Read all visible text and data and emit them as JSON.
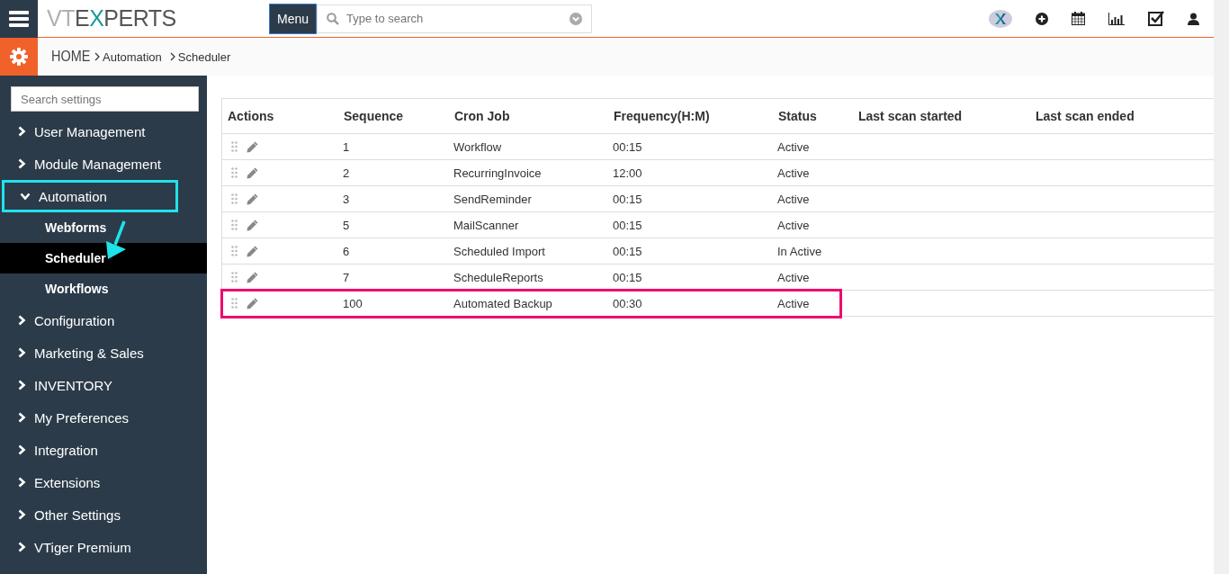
{
  "logo": [
    {
      "text": "VT",
      "color": "#b0b0b0"
    },
    {
      "text": "E",
      "color": "#555555"
    },
    {
      "text": "X",
      "color": "#1a9a9a"
    },
    {
      "text": "PERTS",
      "color": "#555555"
    }
  ],
  "menu_button": "Menu",
  "search": {
    "placeholder": "Type to search"
  },
  "breadcrumb": {
    "home": "HOME",
    "items": [
      "Automation",
      "Scheduler"
    ]
  },
  "sidebar": {
    "search_placeholder": "Search settings",
    "items": [
      {
        "label": "User Management",
        "expanded": false,
        "highlighted": false
      },
      {
        "label": "Module Management",
        "expanded": false,
        "highlighted": false
      },
      {
        "label": "Automation",
        "expanded": true,
        "highlighted": true,
        "children": [
          {
            "label": "Webforms",
            "selected": false
          },
          {
            "label": "Scheduler",
            "selected": true
          },
          {
            "label": "Workflows",
            "selected": false
          }
        ]
      },
      {
        "label": "Configuration",
        "expanded": false,
        "highlighted": false
      },
      {
        "label": "Marketing & Sales",
        "expanded": false,
        "highlighted": false
      },
      {
        "label": "INVENTORY",
        "expanded": false,
        "highlighted": false
      },
      {
        "label": "My Preferences",
        "expanded": false,
        "highlighted": false
      },
      {
        "label": "Integration",
        "expanded": false,
        "highlighted": false
      },
      {
        "label": "Extensions",
        "expanded": false,
        "highlighted": false
      },
      {
        "label": "Other Settings",
        "expanded": false,
        "highlighted": false
      },
      {
        "label": "VTiger Premium",
        "expanded": false,
        "highlighted": false
      }
    ]
  },
  "table": {
    "columns": [
      "Actions",
      "Sequence",
      "Cron Job",
      "Frequency(H:M)",
      "Status",
      "Last scan started",
      "Last scan ended"
    ],
    "rows": [
      {
        "sequence": "1",
        "cron_job": "Workflow",
        "frequency": "00:15",
        "status": "Active",
        "highlighted": false
      },
      {
        "sequence": "2",
        "cron_job": "RecurringInvoice",
        "frequency": "12:00",
        "status": "Active",
        "highlighted": false
      },
      {
        "sequence": "3",
        "cron_job": "SendReminder",
        "frequency": "00:15",
        "status": "Active",
        "highlighted": false
      },
      {
        "sequence": "5",
        "cron_job": "MailScanner",
        "frequency": "00:15",
        "status": "Active",
        "highlighted": false
      },
      {
        "sequence": "6",
        "cron_job": "Scheduled Import",
        "frequency": "00:15",
        "status": "In Active",
        "highlighted": false
      },
      {
        "sequence": "7",
        "cron_job": "ScheduleReports",
        "frequency": "00:15",
        "status": "Active",
        "highlighted": false
      },
      {
        "sequence": "100",
        "cron_job": "Automated Backup",
        "frequency": "00:30",
        "status": "Active",
        "highlighted": true
      }
    ]
  }
}
